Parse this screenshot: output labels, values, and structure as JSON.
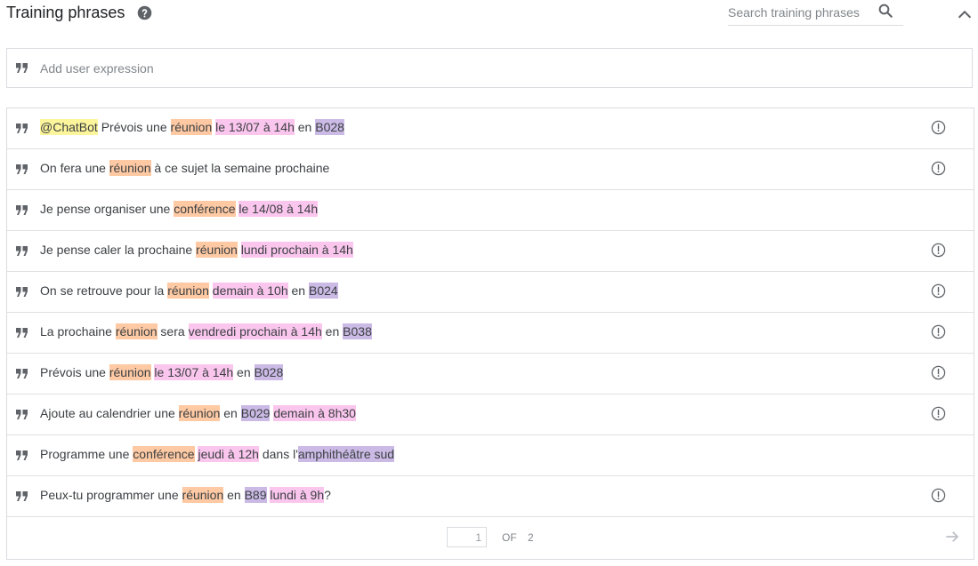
{
  "header": {
    "title": "Training phrases",
    "help_icon": "question-circle-icon",
    "search_placeholder": "Search training phrases",
    "search_icon": "search-icon",
    "collapse_icon": "chevron-up-icon"
  },
  "add_expression": {
    "placeholder": "Add user expression",
    "icon": "quote-icon"
  },
  "entity_colors": {
    "bot": "#fdf59b",
    "event": "#fec9a3",
    "date": "#fbc6ee",
    "room": "#cbbae5"
  },
  "phrases": [
    {
      "warning": true,
      "segments": [
        {
          "text": "@ChatBot",
          "entity": "bot"
        },
        {
          "text": " Prévois une "
        },
        {
          "text": "réunion",
          "entity": "event"
        },
        {
          "text": " "
        },
        {
          "text": "le 13/07 à 14h",
          "entity": "date"
        },
        {
          "text": " en "
        },
        {
          "text": "B028",
          "entity": "room"
        }
      ]
    },
    {
      "warning": true,
      "segments": [
        {
          "text": "On fera une "
        },
        {
          "text": "réunion",
          "entity": "event"
        },
        {
          "text": " à ce sujet la semaine prochaine"
        }
      ]
    },
    {
      "warning": false,
      "segments": [
        {
          "text": "Je pense organiser une "
        },
        {
          "text": "conférence",
          "entity": "event"
        },
        {
          "text": " "
        },
        {
          "text": "le 14/08 à 14h",
          "entity": "date"
        }
      ]
    },
    {
      "warning": true,
      "segments": [
        {
          "text": "Je pense caler la prochaine "
        },
        {
          "text": "réunion",
          "entity": "event"
        },
        {
          "text": " "
        },
        {
          "text": "lundi prochain à 14h",
          "entity": "date"
        }
      ]
    },
    {
      "warning": true,
      "segments": [
        {
          "text": "On se retrouve pour la "
        },
        {
          "text": "réunion",
          "entity": "event"
        },
        {
          "text": " "
        },
        {
          "text": "demain à 10h",
          "entity": "date"
        },
        {
          "text": " en "
        },
        {
          "text": "B024",
          "entity": "room"
        }
      ]
    },
    {
      "warning": true,
      "segments": [
        {
          "text": "La prochaine "
        },
        {
          "text": "réunion",
          "entity": "event"
        },
        {
          "text": " sera "
        },
        {
          "text": "vendredi prochain à 14h",
          "entity": "date"
        },
        {
          "text": " en "
        },
        {
          "text": "B038",
          "entity": "room"
        }
      ]
    },
    {
      "warning": true,
      "segments": [
        {
          "text": "Prévois une "
        },
        {
          "text": "réunion",
          "entity": "event"
        },
        {
          "text": " "
        },
        {
          "text": "le 13/07 à 14h",
          "entity": "date"
        },
        {
          "text": " en "
        },
        {
          "text": "B028",
          "entity": "room"
        }
      ]
    },
    {
      "warning": true,
      "segments": [
        {
          "text": "Ajoute au calendrier une "
        },
        {
          "text": "réunion",
          "entity": "event"
        },
        {
          "text": " en "
        },
        {
          "text": "B029",
          "entity": "room"
        },
        {
          "text": " "
        },
        {
          "text": "demain à 8h30",
          "entity": "date"
        }
      ]
    },
    {
      "warning": false,
      "segments": [
        {
          "text": "Programme une "
        },
        {
          "text": "conférence",
          "entity": "event"
        },
        {
          "text": " "
        },
        {
          "text": "jeudi à 12h",
          "entity": "date"
        },
        {
          "text": " dans l'"
        },
        {
          "text": "amphithéâtre sud",
          "entity": "room"
        }
      ]
    },
    {
      "warning": true,
      "segments": [
        {
          "text": "Peux-tu programmer une "
        },
        {
          "text": "réunion",
          "entity": "event"
        },
        {
          "text": " en "
        },
        {
          "text": "B89",
          "entity": "room"
        },
        {
          "text": " "
        },
        {
          "text": "lundi à 9h",
          "entity": "date"
        },
        {
          "text": "?"
        }
      ]
    }
  ],
  "pagination": {
    "current_page": "1",
    "of_label": "OF",
    "total_pages": "2",
    "next_icon": "arrow-right-icon"
  }
}
